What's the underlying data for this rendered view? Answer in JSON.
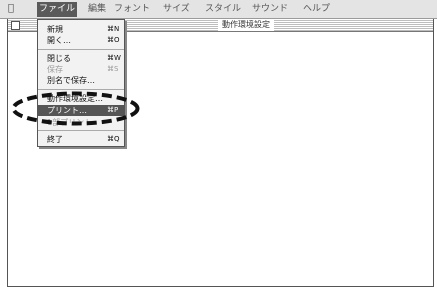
{
  "menubar": {
    "items": [
      {
        "label": "ファイル"
      },
      {
        "label": "編集"
      },
      {
        "label": "フォント"
      },
      {
        "label": "サイズ"
      },
      {
        "label": "スタイル"
      },
      {
        "label": "サウンド"
      },
      {
        "label": "ヘルプ"
      }
    ]
  },
  "window": {
    "title": "動作環境設定"
  },
  "file_menu": {
    "items": [
      {
        "label": "新規",
        "shortcut": "⌘N",
        "state": "normal"
      },
      {
        "label": "開く…",
        "shortcut": "⌘O",
        "state": "normal"
      },
      {
        "label": "閉じる",
        "shortcut": "⌘W",
        "state": "normal"
      },
      {
        "label": "保存",
        "shortcut": "⌘S",
        "state": "disabled"
      },
      {
        "label": "別名で保存…",
        "shortcut": "",
        "state": "normal"
      },
      {
        "label": "動作環境設定…",
        "shortcut": "",
        "state": "normal"
      },
      {
        "label": "プリント…",
        "shortcut": "⌘P",
        "state": "highlighted"
      },
      {
        "label": "1部プリント",
        "shortcut": "",
        "state": "disabled"
      },
      {
        "label": "終了",
        "shortcut": "⌘Q",
        "state": "normal"
      }
    ]
  },
  "annotation": {
    "color": "#111111"
  }
}
